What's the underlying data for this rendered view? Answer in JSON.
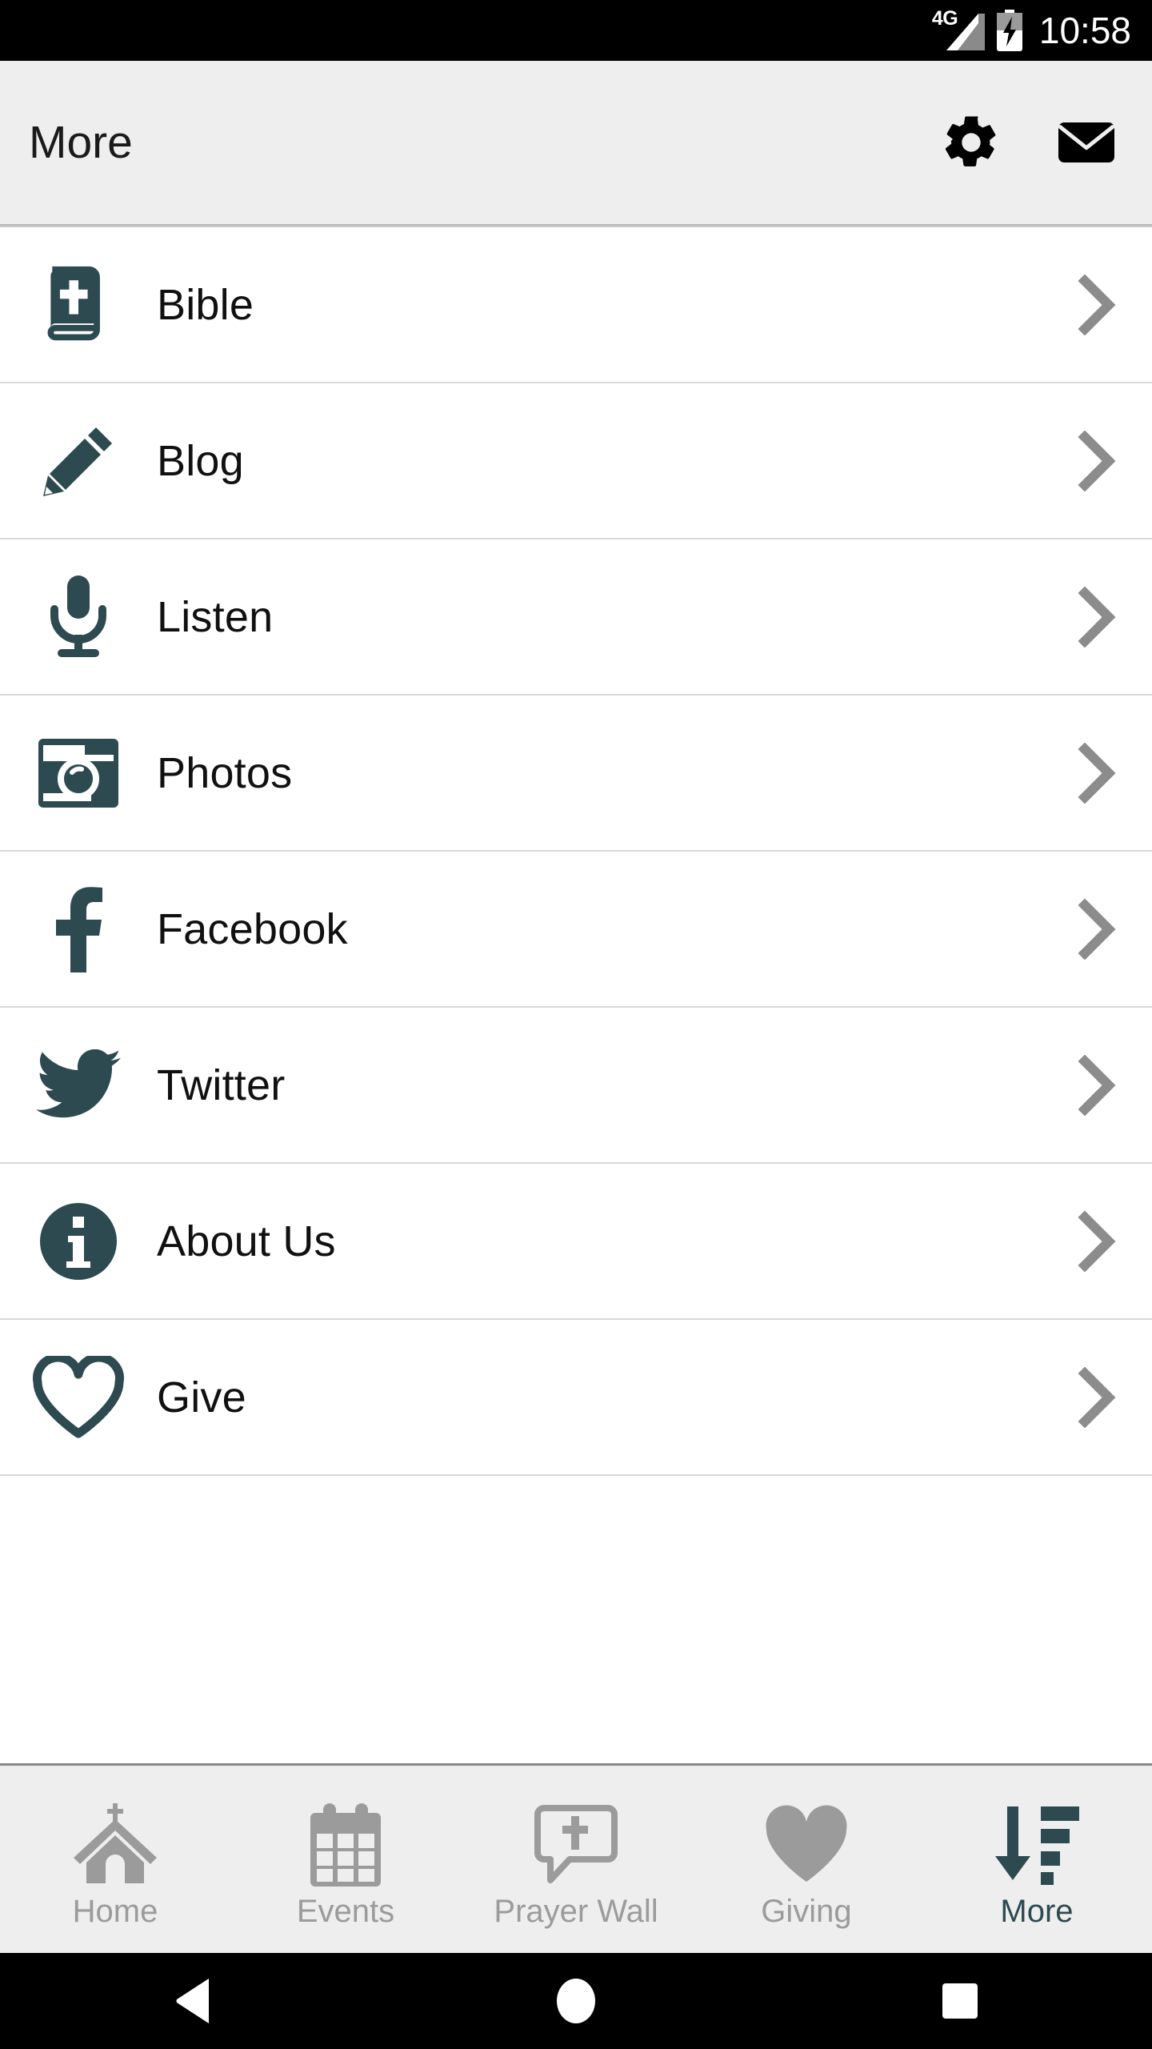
{
  "status_bar": {
    "network_label": "4G",
    "signal_icon": "signal-bars-icon",
    "battery_icon": "battery-charging-icon",
    "time": "10:58"
  },
  "header": {
    "title": "More",
    "actions": [
      {
        "name": "settings-button",
        "icon": "gear-icon"
      },
      {
        "name": "mail-button",
        "icon": "envelope-icon"
      }
    ]
  },
  "theme": {
    "accent": "#2d4a50",
    "header_bg": "#eeeeee",
    "divider": "#d8d8d8",
    "inactive_tab": "#9b9b9b",
    "chevron": "#8c8c8c",
    "text": "#101010"
  },
  "list": {
    "items": [
      {
        "label": "Bible",
        "icon": "bible-book-icon"
      },
      {
        "label": "Blog",
        "icon": "pencil-icon"
      },
      {
        "label": "Listen",
        "icon": "microphone-icon"
      },
      {
        "label": "Photos",
        "icon": "camera-icon"
      },
      {
        "label": "Facebook",
        "icon": "facebook-icon"
      },
      {
        "label": "Twitter",
        "icon": "twitter-bird-icon"
      },
      {
        "label": "About Us",
        "icon": "info-circle-icon"
      },
      {
        "label": "Give",
        "icon": "heart-outline-icon"
      }
    ],
    "chevron_icon": "chevron-right-icon"
  },
  "tab_bar": {
    "items": [
      {
        "label": "Home",
        "icon": "church-icon",
        "active": false
      },
      {
        "label": "Events",
        "icon": "calendar-icon",
        "active": false
      },
      {
        "label": "Prayer Wall",
        "icon": "prayer-bubble-icon",
        "active": false
      },
      {
        "label": "Giving",
        "icon": "heart-filled-icon",
        "active": false
      },
      {
        "label": "More",
        "icon": "sort-descending-icon",
        "active": true
      }
    ]
  },
  "system_nav": {
    "back": "back-triangle-icon",
    "home": "home-circle-icon",
    "recents": "recents-square-icon"
  }
}
